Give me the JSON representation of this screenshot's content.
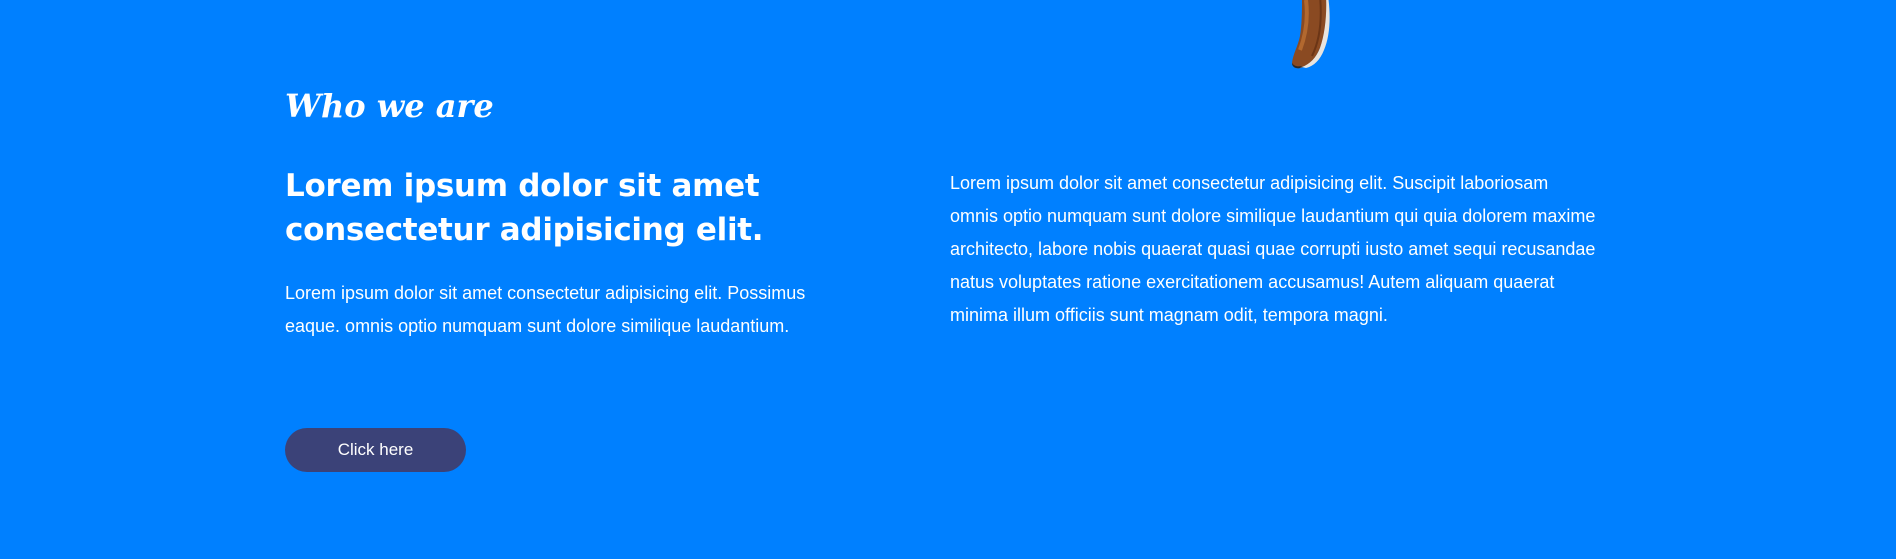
{
  "about": {
    "eyebrow": "Who we are",
    "headline": "Lorem ipsum dolor sit amet consectetur adipisicing elit.",
    "lead": "Lorem ipsum dolor sit amet consectetur adipisicing elit. Possimus eaque. omnis optio numquam sunt dolore similique laudantium.",
    "cta_label": "Click here",
    "side_text": "Lorem ipsum dolor sit amet consectetur adipisicing elit. Suscipit laboriosam omnis optio numquam sunt dolore similique laudantium qui quia dolorem maxime architecto, labore nobis quaerat quasi quae corrupti iusto amet sequi recusandae natus voluptates ratione exercitationem accusamus! Autem aliquam quaerat minima illum officiis sunt magnam odit, tempora magni."
  },
  "colors": {
    "background": "#0080ff",
    "button": "#3b4278",
    "text": "#ffffff"
  },
  "decor": {
    "shoe_image": "brown-shoe-image"
  }
}
